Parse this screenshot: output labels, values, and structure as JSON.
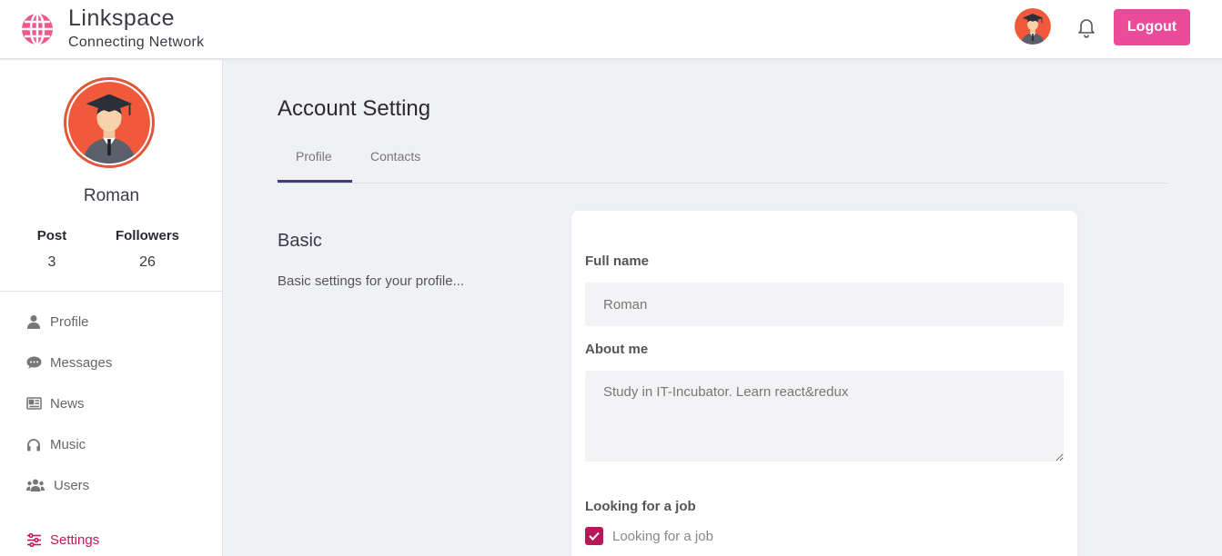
{
  "brand": {
    "title": "Linkspace",
    "subtitle": "Connecting Network"
  },
  "header": {
    "logout_label": "Logout"
  },
  "sidebar": {
    "name": "Roman",
    "stats": [
      {
        "label": "Post",
        "value": "3"
      },
      {
        "label": "Followers",
        "value": "26"
      }
    ],
    "items": [
      {
        "label": "Profile",
        "icon": "user-icon"
      },
      {
        "label": "Messages",
        "icon": "chat-icon"
      },
      {
        "label": "News",
        "icon": "newspaper-icon"
      },
      {
        "label": "Music",
        "icon": "headphones-icon"
      },
      {
        "label": "Users",
        "icon": "users-icon"
      },
      {
        "label": "Settings",
        "icon": "sliders-icon",
        "active": true
      }
    ]
  },
  "main": {
    "title": "Account Setting",
    "tabs": [
      {
        "label": "Profile",
        "active": true
      },
      {
        "label": "Contacts"
      }
    ],
    "section": {
      "title": "Basic",
      "description": "Basic settings for your profile..."
    },
    "form": {
      "full_name": {
        "label": "Full name",
        "value": "Roman"
      },
      "about_me": {
        "label": "About me",
        "value": "Study in IT-Incubator. Learn react&redux"
      },
      "looking_for_job": {
        "label": "Looking for a job",
        "checkbox_label": "Looking for a job",
        "checked": true
      }
    }
  },
  "colors": {
    "accent": "#ec4a9a",
    "active_nav": "#c2185b",
    "tab_indicator": "#3b3f74",
    "checkbox": "#b8185a"
  }
}
